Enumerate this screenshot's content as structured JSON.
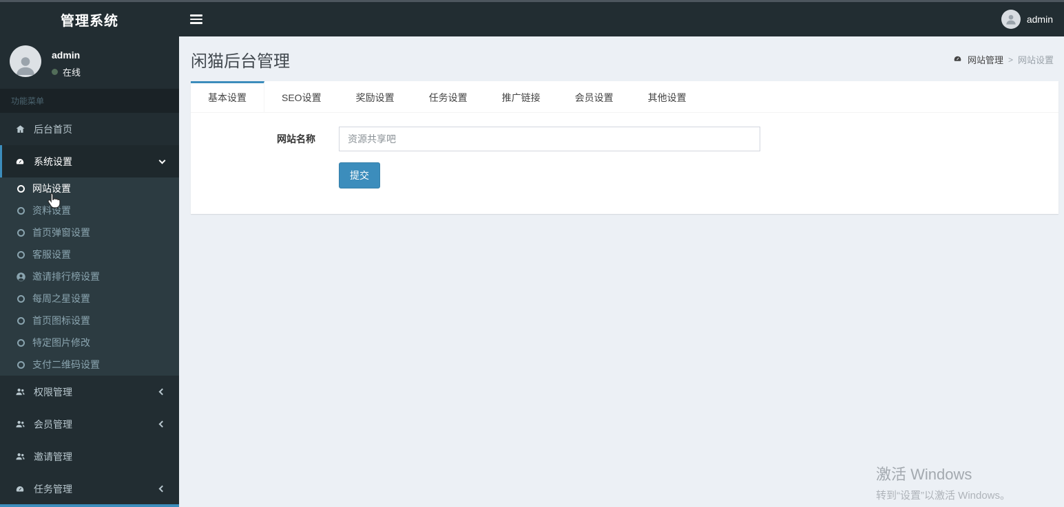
{
  "navbar": {
    "brand": "管理系统",
    "user_name": "admin"
  },
  "sidebar": {
    "user": {
      "name": "admin",
      "status": "在线"
    },
    "section_header": "功能菜单",
    "items": [
      {
        "label": "后台首页",
        "icon": "home-icon"
      },
      {
        "label": "系统设置",
        "icon": "gauge-icon",
        "expanded": true,
        "active": true,
        "children": [
          {
            "label": "网站设置",
            "icon": "circle-icon",
            "active": true
          },
          {
            "label": "资料设置",
            "icon": "circle-icon"
          },
          {
            "label": "首页弹窗设置",
            "icon": "circle-icon"
          },
          {
            "label": "客服设置",
            "icon": "circle-icon"
          },
          {
            "label": "邀请排行榜设置",
            "icon": "user-circle-icon"
          },
          {
            "label": "每周之星设置",
            "icon": "circle-icon"
          },
          {
            "label": "首页图标设置",
            "icon": "circle-icon"
          },
          {
            "label": "特定图片修改",
            "icon": "circle-icon"
          },
          {
            "label": "支付二维码设置",
            "icon": "circle-icon"
          }
        ]
      },
      {
        "label": "权限管理",
        "icon": "users-icon",
        "collapsible": true
      },
      {
        "label": "会员管理",
        "icon": "users-icon",
        "collapsible": true
      },
      {
        "label": "邀请管理",
        "icon": "users-icon"
      },
      {
        "label": "任务管理",
        "icon": "gauge-icon",
        "collapsible": true
      }
    ]
  },
  "content": {
    "page_title": "闲猫后台管理",
    "breadcrumb": {
      "parent": "网站管理",
      "separator": ">",
      "current": "网站设置"
    },
    "tabs": [
      "基本设置",
      "SEO设置",
      "奖励设置",
      "任务设置",
      "推广链接",
      "会员设置",
      "其他设置"
    ],
    "active_tab": "基本设置",
    "form": {
      "site_name_label": "网站名称",
      "site_name_value": "资源共享吧",
      "submit_label": "提交"
    }
  },
  "watermark": {
    "line1": "激活 Windows",
    "line2": "转到“设置”以激活 Windows。"
  },
  "colors": {
    "accent": "#3c8dbc",
    "topbar_bg": "#222d32",
    "sidebar_bg": "#222d32",
    "submenu_bg": "#2c3b41",
    "content_bg": "#ecf0f5",
    "status_dot": "#5f7d63"
  }
}
